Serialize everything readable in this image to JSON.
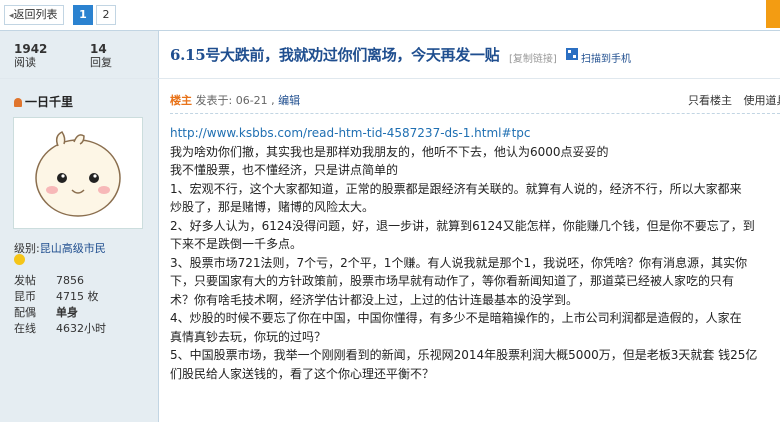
{
  "topbar": {
    "back_label": "返回列表",
    "pages": [
      "1",
      "2"
    ]
  },
  "stats": {
    "views_count": "1942",
    "views_label": "阅读",
    "replies_count": "14",
    "replies_label": "回复"
  },
  "thread": {
    "title": "6.15号大跌前，我就劝过你们离场，今天再发一贴",
    "copy_link": "[复制链接]",
    "scan_label": "扫描到手机"
  },
  "author": {
    "name": "一日千里",
    "level_prefix": "级别:",
    "level": "昆山高级市民",
    "profile": [
      {
        "k": "发帖",
        "v": "7856"
      },
      {
        "k": "昆币",
        "v": "4715 枚"
      },
      {
        "k": "配偶",
        "v": "单身"
      },
      {
        "k": "在线",
        "v": "4632小时"
      }
    ]
  },
  "post": {
    "owner_tag": "楼主",
    "posted": "发表于: 06-21 ,",
    "edit": "编辑",
    "only_owner": "只看楼主",
    "use_tool": "使用道具",
    "lines": [
      "http://www.ksbbs.com/read-htm-tid-4587237-ds-1.html#tpc",
      "我为啥劝你们撤，其实我也是那样劝我朋友的，他听不下去，他认为6000点妥妥的",
      "我不懂股票，也不懂经济，只是讲点简单的",
      "1、宏观不行，这个大家都知道，正常的股票都是跟经济有关联的。就算有人说的，经济不行，所以大家都来",
      "炒股了，那是赌博，赌博的风险太大。",
      "2、好多人认为，6124没得问题，好，退一步讲，就算到6124又能怎样，你能赚几个钱，但是你不要忘了，到",
      "下来不是跌倒一千多点。",
      "3、股票市场721法则，7个亏，2个平，1个赚。有人说我就是那个1，我说呸，你凭啥？你有消息源，其实你",
      "下，只要国家有大的方针政策前，股票市场早就有动作了，等你看新闻知道了，那道菜已经被人家吃的只有",
      "术？你有啥毛技术啊，经济学估计都没上过，上过的估计连最基本的没学到。",
      "4、炒股的时候不要忘了你在中国，中国你懂得，有多少不是暗箱操作的，上市公司利润都是造假的，人家在",
      "真情真钞去玩，你玩的过吗？",
      "5、中国股票市场，我举一个刚刚看到的新闻，乐视网2014年股票利润大概5000万，但是老板3天就套 钱25亿",
      "们股民给人家送钱的，看了这个你心理还平衡不？"
    ]
  },
  "colors": {
    "accent": "#2b82d0",
    "title": "#1f4e8f",
    "sidebar": "#e5edf2",
    "owner": "#e8731a"
  }
}
